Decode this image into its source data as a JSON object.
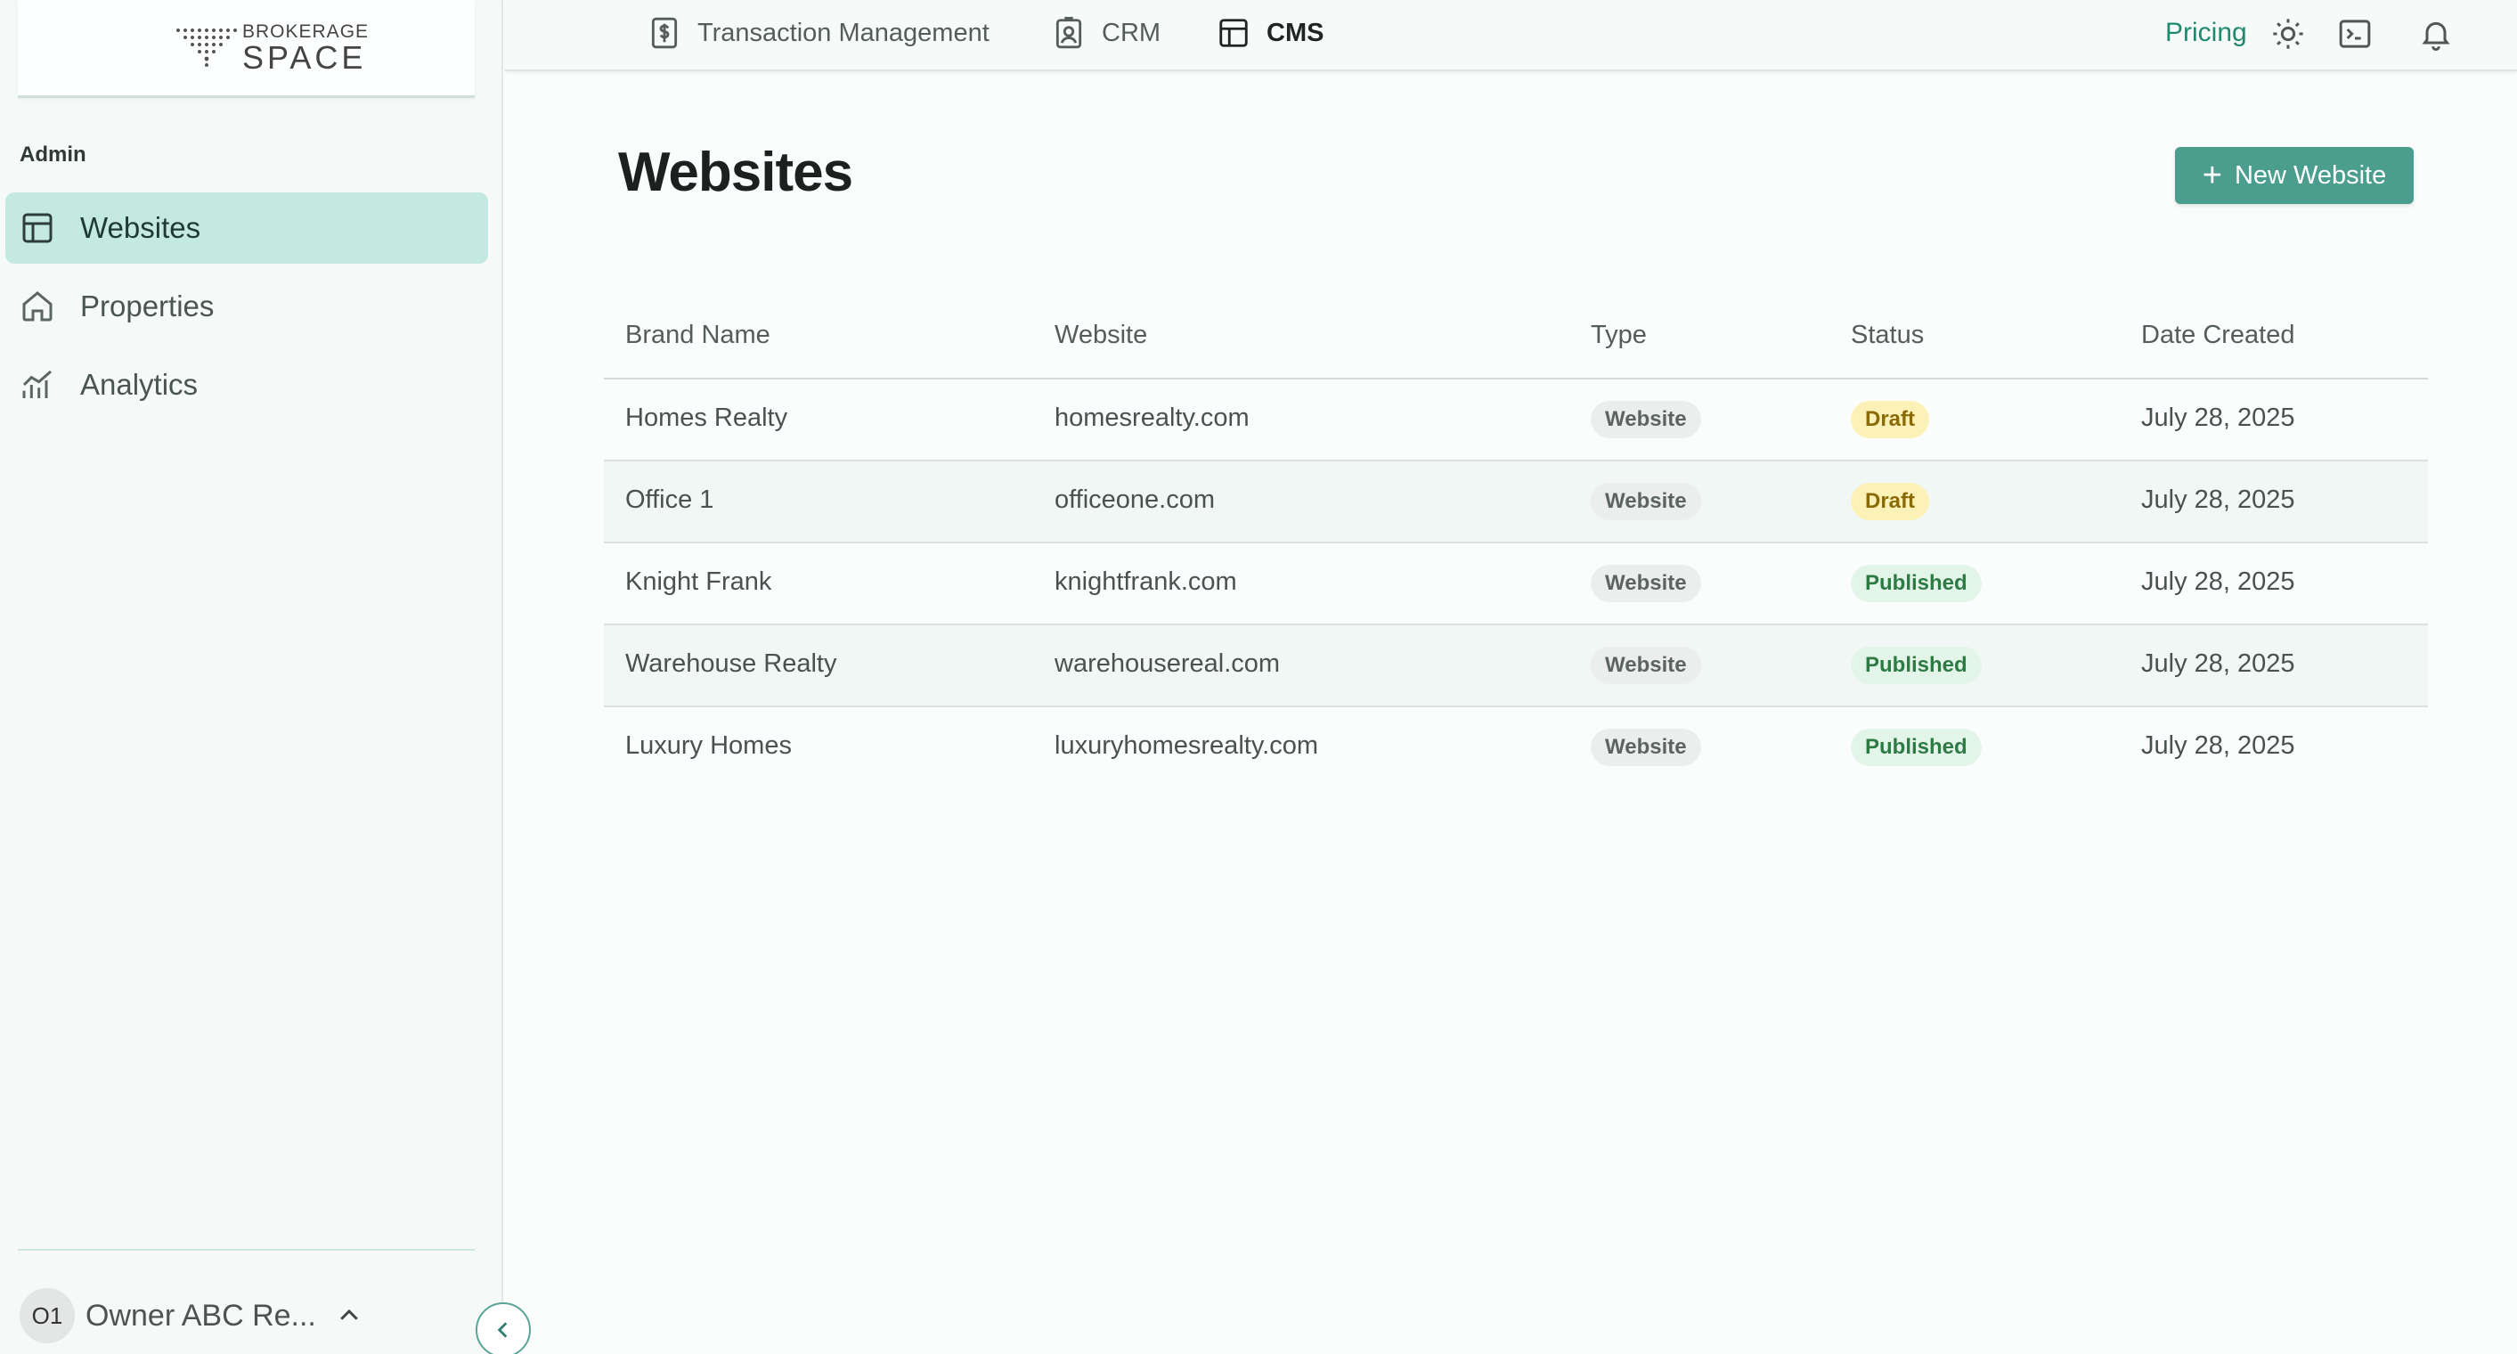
{
  "brand": {
    "line1": "BROKERAGE",
    "line2": "SPACE"
  },
  "sidebar": {
    "section": "Admin",
    "items": [
      {
        "label": "Websites",
        "icon": "layout-icon",
        "active": true
      },
      {
        "label": "Properties",
        "icon": "home-icon",
        "active": false
      },
      {
        "label": "Analytics",
        "icon": "chart-icon",
        "active": false
      }
    ],
    "user": {
      "initials": "O1",
      "name": "Owner ABC Re..."
    }
  },
  "topnav": {
    "items": [
      {
        "label": "Transaction Management",
        "icon": "dollar-document-icon"
      },
      {
        "label": "CRM",
        "icon": "contact-card-icon"
      },
      {
        "label": "CMS",
        "icon": "layout-icon",
        "active": true
      }
    ],
    "pricing": "Pricing"
  },
  "page": {
    "title": "Websites",
    "new_button": "New Website"
  },
  "table": {
    "headers": [
      "Brand Name",
      "Website",
      "Type",
      "Status",
      "Date Created"
    ],
    "rows": [
      {
        "brand": "Homes Realty",
        "website": "homesrealty.com",
        "type": "Website",
        "status": "Draft",
        "date": "July 28, 2025"
      },
      {
        "brand": "Office 1",
        "website": "officeone.com",
        "type": "Website",
        "status": "Draft",
        "date": "July 28, 2025"
      },
      {
        "brand": "Knight Frank",
        "website": "knightfrank.com",
        "type": "Website",
        "status": "Published",
        "date": "July 28, 2025"
      },
      {
        "brand": "Warehouse Realty",
        "website": "warehousereal.com",
        "type": "Website",
        "status": "Published",
        "date": "July 28, 2025"
      },
      {
        "brand": "Luxury Homes",
        "website": "luxuryhomesrealty.com",
        "type": "Website",
        "status": "Published",
        "date": "July 28, 2025"
      }
    ]
  },
  "colors": {
    "accent": "#4b9d8d",
    "active_nav": "#c3e9e0",
    "pricing": "#1f8a70",
    "draft": "#fcf2b8",
    "published": "#e3f4e8"
  }
}
